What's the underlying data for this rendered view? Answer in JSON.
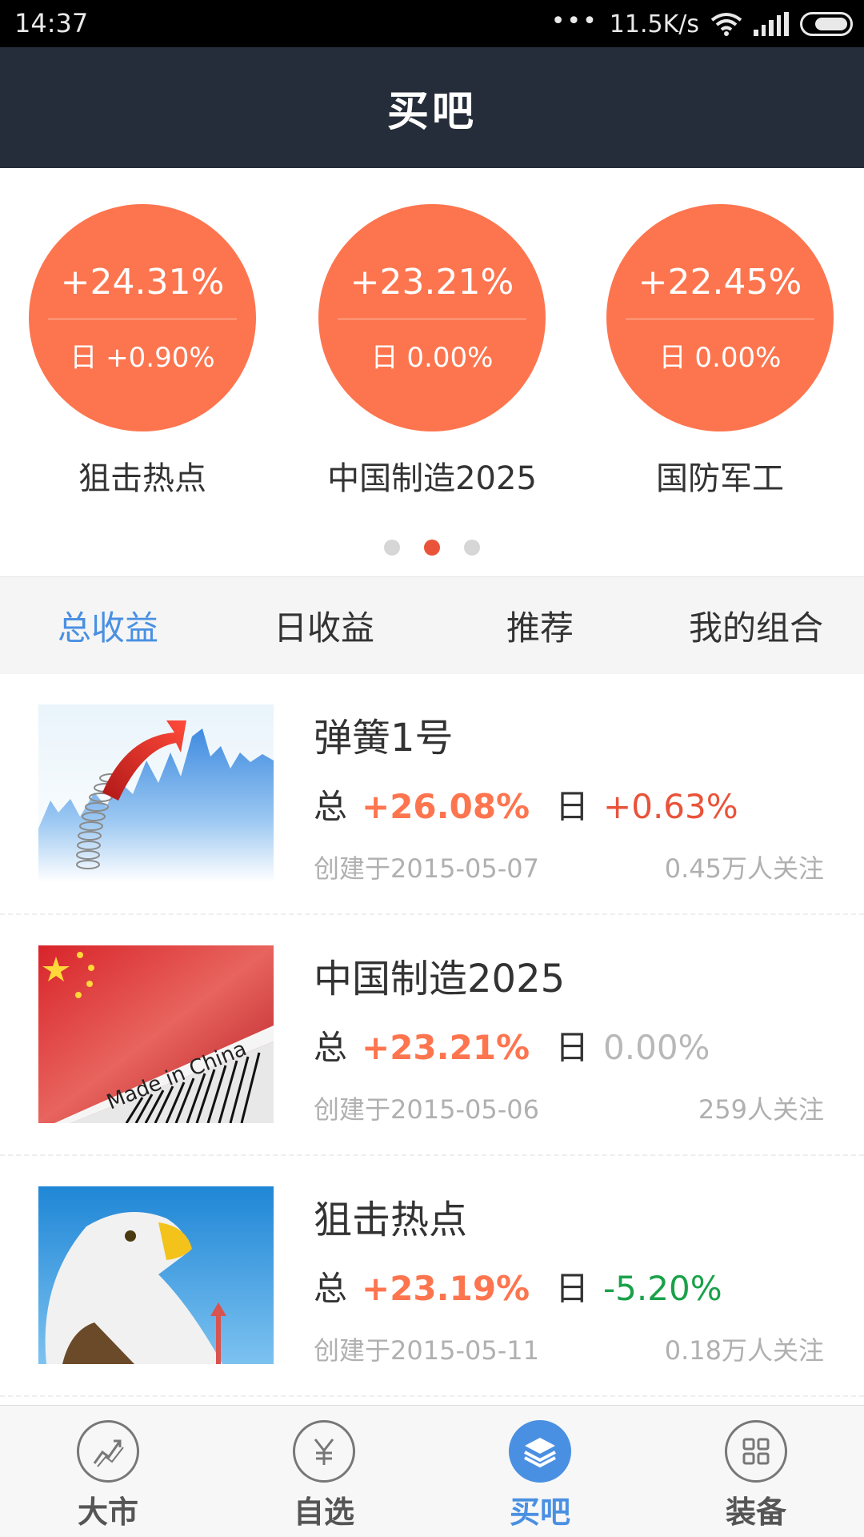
{
  "status_bar": {
    "time": "14:37",
    "network_speed": "11.5K/s",
    "dots": "•••"
  },
  "header": {
    "title": "买吧"
  },
  "featured": [
    {
      "total": "+24.31%",
      "day": "日 +0.90%",
      "name": "狙击热点"
    },
    {
      "total": "+23.21%",
      "day": "日 0.00%",
      "name": "中国制造2025"
    },
    {
      "total": "+22.45%",
      "day": "日 0.00%",
      "name": "国防军工"
    }
  ],
  "pager": {
    "count": 3,
    "active_index": 1
  },
  "tabs": [
    {
      "label": "总收益",
      "active": true
    },
    {
      "label": "日收益",
      "active": false
    },
    {
      "label": "推荐",
      "active": false
    },
    {
      "label": "我的组合",
      "active": false
    }
  ],
  "portfolios": [
    {
      "title": "弹簧1号",
      "total_label": "总",
      "total": "+26.08%",
      "day_label": "日",
      "day": "+0.63%",
      "day_trend": "pos",
      "created": "创建于2015-05-07",
      "followers": "0.45万人关注",
      "image": "spring-chart-image"
    },
    {
      "title": "中国制造2025",
      "total_label": "总",
      "total": "+23.21%",
      "day_label": "日",
      "day": "0.00%",
      "day_trend": "zero",
      "created": "创建于2015-05-06",
      "followers": "259人关注",
      "image": "made-in-china-flag-image",
      "image_text": "Made in China"
    },
    {
      "title": "狙击热点",
      "total_label": "总",
      "total": "+23.19%",
      "day_label": "日",
      "day": "-5.20%",
      "day_trend": "neg",
      "created": "创建于2015-05-11",
      "followers": "0.18万人关注",
      "image": "eagle-image"
    }
  ],
  "bottom_nav": [
    {
      "label": "大市",
      "icon": "market-chart-icon",
      "active": false
    },
    {
      "label": "自选",
      "icon": "yuan-icon",
      "active": false
    },
    {
      "label": "买吧",
      "icon": "layers-icon",
      "active": true
    },
    {
      "label": "装备",
      "icon": "grid-icon",
      "active": false
    }
  ],
  "colors": {
    "accent": "#4a90e2",
    "header_bg": "#262d3a",
    "circle": "#fd754f",
    "up": "#e9533a",
    "down": "#1aa14a"
  }
}
